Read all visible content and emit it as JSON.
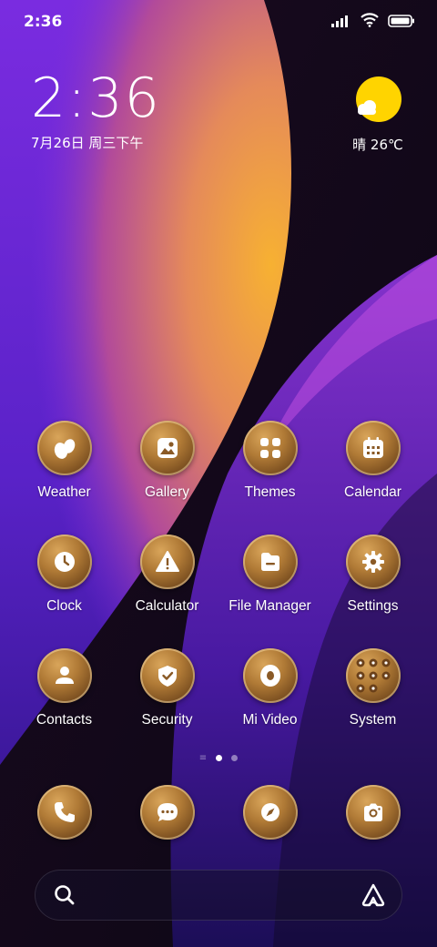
{
  "status_bar": {
    "time": "2:36"
  },
  "clock_widget": {
    "time": "2:36",
    "date": "7月26日 周三下午"
  },
  "weather_widget": {
    "text": "晴 26℃",
    "icon": "sun-cloud-icon"
  },
  "apps": [
    [
      {
        "label": "Weather",
        "icon": "weather-icon"
      },
      {
        "label": "Gallery",
        "icon": "gallery-icon"
      },
      {
        "label": "Themes",
        "icon": "themes-icon"
      },
      {
        "label": "Calendar",
        "icon": "calendar-icon"
      }
    ],
    [
      {
        "label": "Clock",
        "icon": "clock-icon"
      },
      {
        "label": "Calculator",
        "icon": "warning-icon"
      },
      {
        "label": "File Manager",
        "icon": "folder-icon"
      },
      {
        "label": "Settings",
        "icon": "gear-icon"
      }
    ],
    [
      {
        "label": "Contacts",
        "icon": "contacts-icon"
      },
      {
        "label": "Security",
        "icon": "shield-icon"
      },
      {
        "label": "Mi Video",
        "icon": "video-icon"
      },
      {
        "label": "System",
        "icon": "folder-grid-icon"
      }
    ]
  ],
  "dock": [
    {
      "icon": "phone-icon"
    },
    {
      "icon": "messages-icon"
    },
    {
      "icon": "browser-icon"
    },
    {
      "icon": "camera-icon"
    }
  ],
  "pager": {
    "pages": 2,
    "active": 1
  },
  "search": {
    "placeholder": ""
  },
  "colors": {
    "icon_gold": "#b07a36",
    "wallpaper_purple": "#7b2fe0",
    "wallpaper_orange": "#f0a030"
  }
}
